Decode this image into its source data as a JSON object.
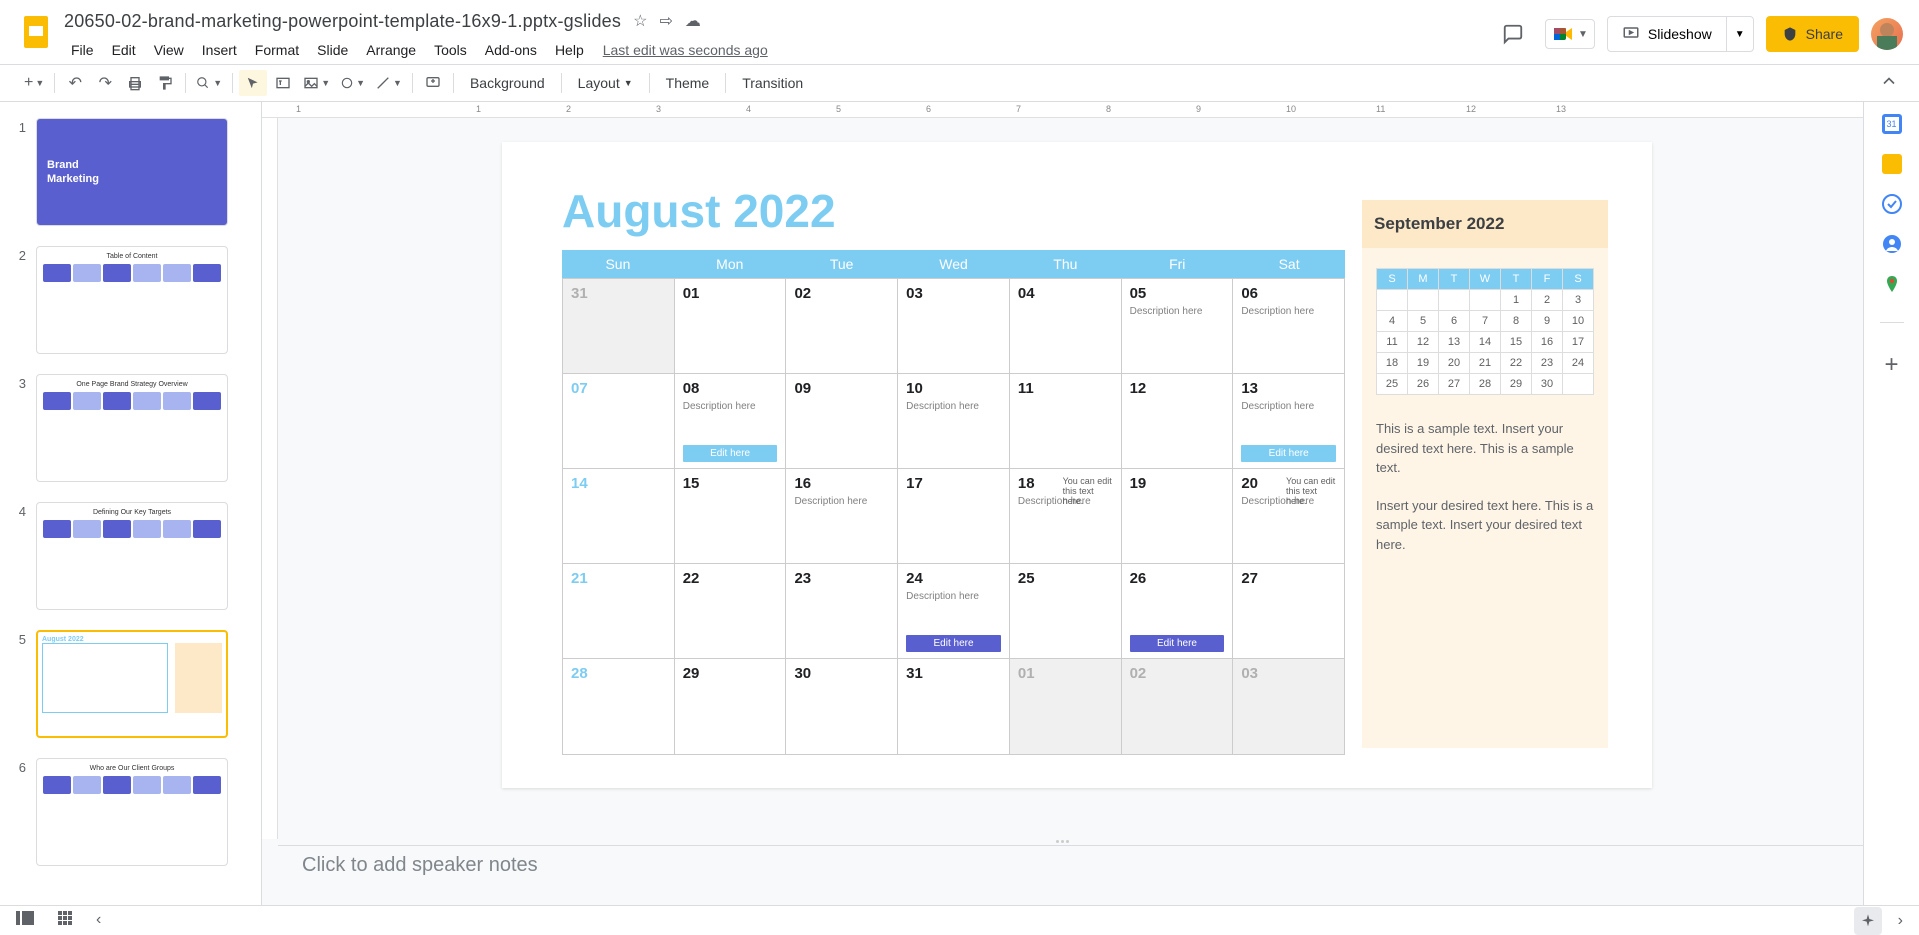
{
  "document": {
    "title": "20650-02-brand-marketing-powerpoint-template-16x9-1.pptx-gslides",
    "last_edit": "Last edit was seconds ago"
  },
  "menus": [
    "File",
    "Edit",
    "View",
    "Insert",
    "Format",
    "Slide",
    "Arrange",
    "Tools",
    "Add-ons",
    "Help"
  ],
  "toolbar": {
    "background": "Background",
    "layout": "Layout",
    "theme": "Theme",
    "transition": "Transition"
  },
  "header_buttons": {
    "slideshow": "Slideshow",
    "share": "Share"
  },
  "slides": [
    {
      "num": "1",
      "title": "Brand\nMarketing"
    },
    {
      "num": "2",
      "title": "Table of Content"
    },
    {
      "num": "3",
      "title": "One Page Brand Strategy Overview"
    },
    {
      "num": "4",
      "title": "Defining Our Key Targets"
    },
    {
      "num": "5",
      "title": "August 2022"
    },
    {
      "num": "6",
      "title": "Who are Our Client Groups"
    }
  ],
  "calendar": {
    "title": "August 2022",
    "weekdays": [
      "Sun",
      "Mon",
      "Tue",
      "Wed",
      "Thu",
      "Fri",
      "Sat"
    ],
    "rows": [
      [
        {
          "day": "31",
          "muted": true
        },
        {
          "day": "01"
        },
        {
          "day": "02"
        },
        {
          "day": "03"
        },
        {
          "day": "04"
        },
        {
          "day": "05",
          "desc": "Description here"
        },
        {
          "day": "06",
          "desc": "Description here"
        }
      ],
      [
        {
          "day": "07",
          "weekend": true
        },
        {
          "day": "08",
          "desc": "Description here",
          "tag": "Edit here",
          "tag_style": "light"
        },
        {
          "day": "09"
        },
        {
          "day": "10",
          "desc": "Description here"
        },
        {
          "day": "11"
        },
        {
          "day": "12"
        },
        {
          "day": "13",
          "desc": "Description here",
          "tag": "Edit here",
          "tag_style": "light"
        }
      ],
      [
        {
          "day": "14",
          "weekend": true
        },
        {
          "day": "15"
        },
        {
          "day": "16",
          "desc": "Description here"
        },
        {
          "day": "17"
        },
        {
          "day": "18",
          "desc": "Description here",
          "note": "You can edit this text here."
        },
        {
          "day": "19"
        },
        {
          "day": "20",
          "desc": "Description here",
          "note": "You can edit this text here."
        }
      ],
      [
        {
          "day": "21",
          "weekend": true
        },
        {
          "day": "22"
        },
        {
          "day": "23"
        },
        {
          "day": "24",
          "desc": "Description here",
          "tag": "Edit here",
          "tag_style": "dark"
        },
        {
          "day": "25"
        },
        {
          "day": "26",
          "tag": "Edit here",
          "tag_style": "dark"
        },
        {
          "day": "27"
        }
      ],
      [
        {
          "day": "28",
          "weekend": true
        },
        {
          "day": "29"
        },
        {
          "day": "30"
        },
        {
          "day": "31"
        },
        {
          "day": "01",
          "muted": true
        },
        {
          "day": "02",
          "muted": true
        },
        {
          "day": "03",
          "muted": true
        }
      ]
    ]
  },
  "mini_calendar": {
    "title": "September 2022",
    "weekdays": [
      "S",
      "M",
      "T",
      "W",
      "T",
      "F",
      "S"
    ],
    "rows": [
      [
        "",
        "",
        "",
        "",
        "1",
        "2",
        "3"
      ],
      [
        "4",
        "5",
        "6",
        "7",
        "8",
        "9",
        "10"
      ],
      [
        "11",
        "12",
        "13",
        "14",
        "15",
        "16",
        "17"
      ],
      [
        "18",
        "19",
        "20",
        "21",
        "22",
        "23",
        "24"
      ],
      [
        "25",
        "26",
        "27",
        "28",
        "29",
        "30",
        ""
      ]
    ],
    "text1": "This is a sample text. Insert your desired text here. This is a sample text.",
    "text2": "Insert your desired text here. This is a sample text. Insert your desired text here."
  },
  "speaker_notes_placeholder": "Click to add speaker notes",
  "ruler_labels": [
    "1",
    "",
    "1",
    "2",
    "3",
    "4",
    "5",
    "6",
    "7",
    "8",
    "9",
    "10",
    "11",
    "12",
    "13"
  ]
}
